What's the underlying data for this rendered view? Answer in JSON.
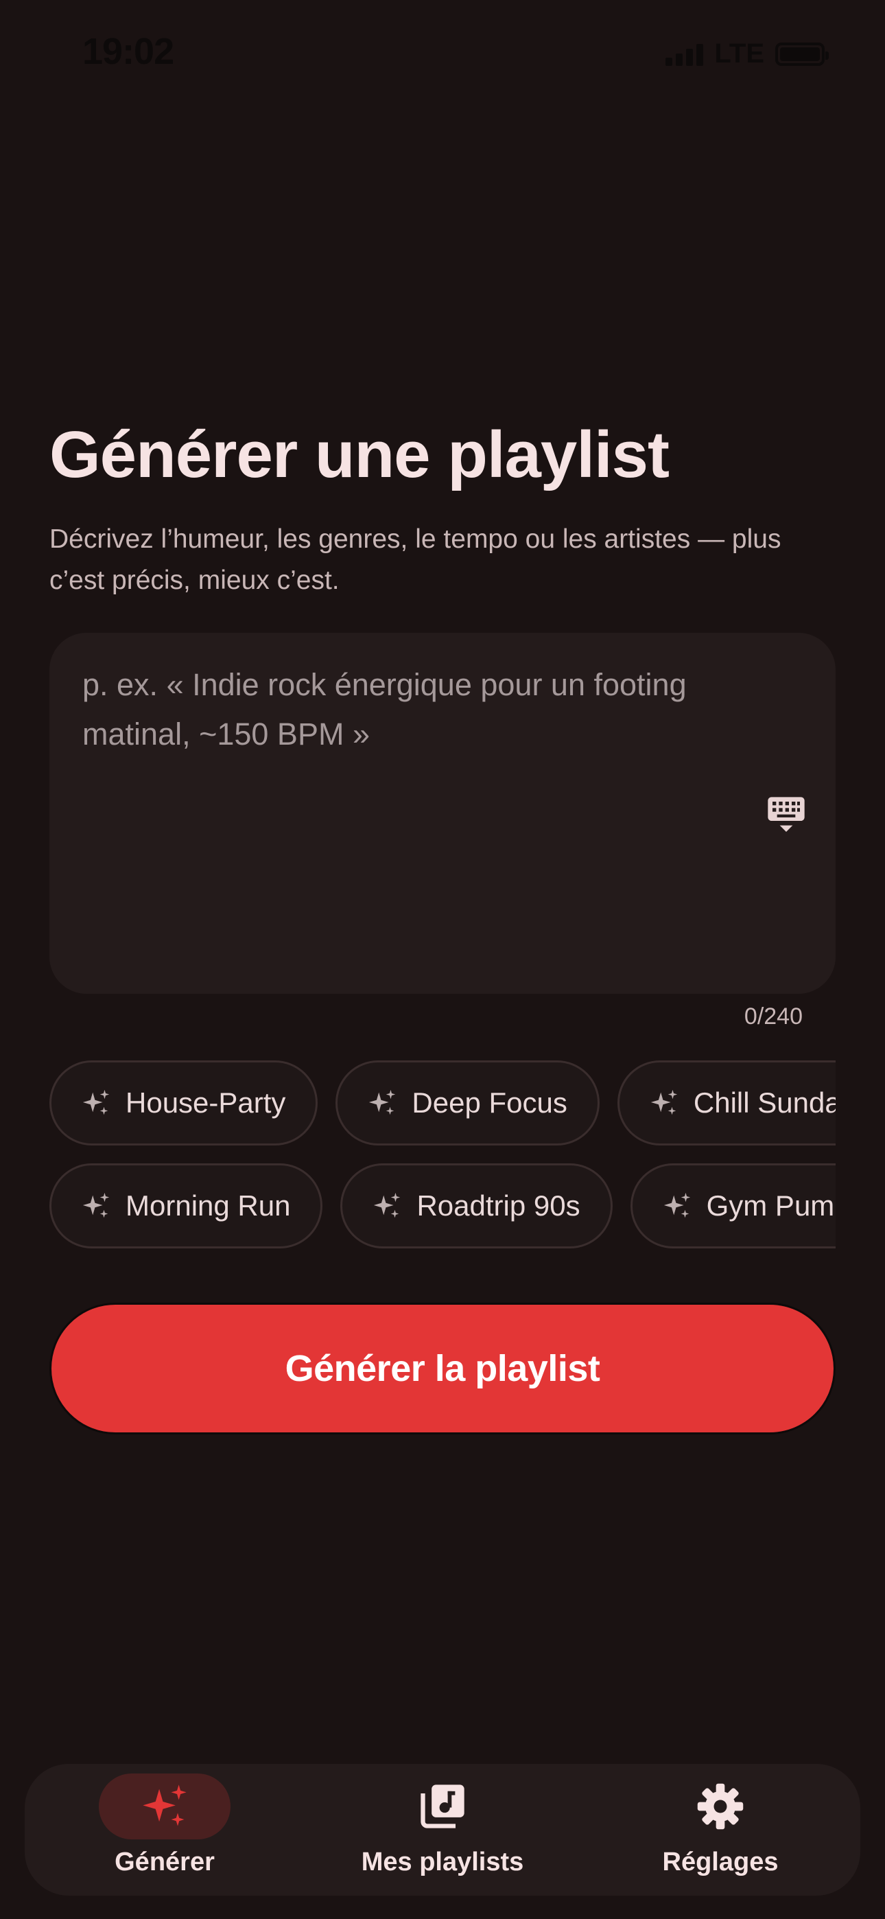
{
  "status": {
    "time": "19:02",
    "network": "LTE"
  },
  "header": {
    "title": "Générer une playlist",
    "subtitle": "Décrivez l’humeur, les genres, le tempo ou les artistes — plus c’est précis, mieux c’est."
  },
  "prompt": {
    "value": "",
    "placeholder": "p. ex. « Indie rock énergique pour un footing matinal, ~150 BPM »",
    "counter": "0/240"
  },
  "suggestions": {
    "row1": [
      "House-Party",
      "Deep Focus",
      "Chill Sunday"
    ],
    "row2": [
      "Morning Run",
      "Roadtrip 90s",
      "Gym Pump"
    ]
  },
  "actions": {
    "generate_label": "Générer la playlist"
  },
  "nav": {
    "items": [
      {
        "label": "Générer",
        "icon": "sparkles-icon",
        "active": true
      },
      {
        "label": "Mes playlists",
        "icon": "library-music-icon",
        "active": false
      },
      {
        "label": "Réglages",
        "icon": "gear-icon",
        "active": false
      }
    ]
  },
  "colors": {
    "background": "#1a1212",
    "surface": "#241b1b",
    "accent": "#e33636",
    "text": "#f6e3e3"
  }
}
